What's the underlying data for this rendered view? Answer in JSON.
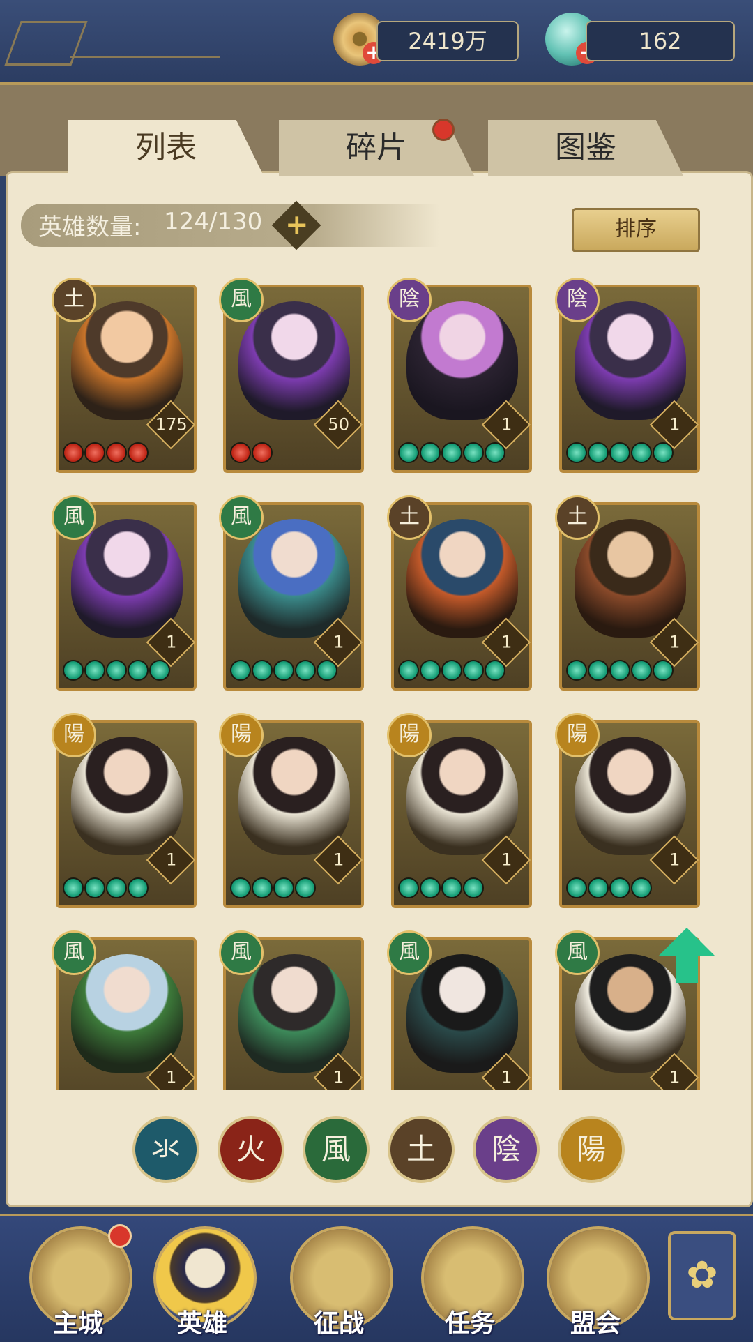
{
  "resources": {
    "coin": {
      "value": "2419万",
      "icon": "coin-icon",
      "add_icon": "plus-icon"
    },
    "gem": {
      "value": "162",
      "icon": "jade-shell-icon",
      "add_icon": "plus-icon"
    }
  },
  "tabs": [
    {
      "label": "列表",
      "active": true
    },
    {
      "label": "碎片",
      "active": false,
      "badge": true
    },
    {
      "label": "图鉴",
      "active": false
    }
  ],
  "hero_count": {
    "label": "英雄数量:",
    "value": "124/130",
    "add_label": "+"
  },
  "sort_label": "排序",
  "heroes": [
    {
      "element": "土",
      "level": "175",
      "stars": 4,
      "star_color": "red"
    },
    {
      "element": "風",
      "level": "50",
      "stars": 2,
      "star_color": "red"
    },
    {
      "element": "陰",
      "level": "1",
      "stars": 5,
      "star_color": "green"
    },
    {
      "element": "陰",
      "level": "1",
      "stars": 5,
      "star_color": "green"
    },
    {
      "element": "風",
      "level": "1",
      "stars": 5,
      "star_color": "green"
    },
    {
      "element": "風",
      "level": "1",
      "stars": 5,
      "star_color": "green"
    },
    {
      "element": "土",
      "level": "1",
      "stars": 5,
      "star_color": "green"
    },
    {
      "element": "土",
      "level": "1",
      "stars": 5,
      "star_color": "green"
    },
    {
      "element": "陽",
      "level": "1",
      "stars": 4,
      "star_color": "green"
    },
    {
      "element": "陽",
      "level": "1",
      "stars": 4,
      "star_color": "green"
    },
    {
      "element": "陽",
      "level": "1",
      "stars": 4,
      "star_color": "green"
    },
    {
      "element": "陽",
      "level": "1",
      "stars": 4,
      "star_color": "green"
    },
    {
      "element": "風",
      "level": "1",
      "stars": 0,
      "star_color": "green"
    },
    {
      "element": "風",
      "level": "1",
      "stars": 0,
      "star_color": "green"
    },
    {
      "element": "風",
      "level": "1",
      "stars": 0,
      "star_color": "green"
    },
    {
      "element": "風",
      "level": "1",
      "stars": 0,
      "star_color": "green"
    }
  ],
  "filters": [
    "氺",
    "火",
    "風",
    "土",
    "陰",
    "陽"
  ],
  "nav": {
    "main": "主城",
    "hero": "英雄",
    "battle": "征战",
    "task": "任务",
    "guild": "盟会",
    "more_icon": "flower-menu-icon"
  }
}
